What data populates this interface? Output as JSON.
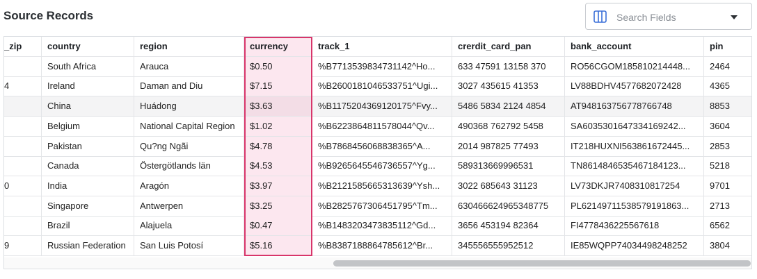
{
  "panel": {
    "title": "Source Records",
    "search": {
      "placeholder": "Search Fields",
      "icon": "columns-icon"
    }
  },
  "colors": {
    "highlight_border": "#d8356a",
    "highlight_fill": "#fce7ef"
  },
  "table": {
    "columns": [
      "_zip",
      "country",
      "region",
      "currency",
      "track_1",
      "crerdit_card_pan",
      "bank_account",
      "pin"
    ],
    "rows": [
      [
        "",
        "South Africa",
        "Arauca",
        "$0.50",
        "%B7713539834731142^Ho...",
        "633 47591 13158 370",
        "RO56CGOM185810214448...",
        "2464"
      ],
      [
        "4",
        "Ireland",
        "Daman and Diu",
        "$7.15",
        "%B2600181046533751^Ugi...",
        "3027 435615 41353",
        "LV88BDHV4577682072428",
        "4365"
      ],
      [
        "",
        "China",
        "Huádong",
        "$3.63",
        "%B1175204369120175^Fvy...",
        "5486 5834 2124 4854",
        "AT948163756778766748",
        "8853"
      ],
      [
        "",
        "Belgium",
        "National Capital Region",
        "$1.02",
        "%B6223864811578044^Qv...",
        "490368 762792 5458",
        "SA603530164733416924​2...",
        "3604"
      ],
      [
        "",
        "Pakistan",
        "Qu?ng Ngãi",
        "$4.78",
        "%B7868456068838365^A...",
        "2014 987825 77493",
        "IT218HUXNI563861672445...",
        "2853"
      ],
      [
        "",
        "Canada",
        "Östergötlands län",
        "$4.53",
        "%B9265645546736557^Yg...",
        "589313669996531",
        "TN8614846535467184123...",
        "5218"
      ],
      [
        "0",
        "India",
        "Aragón",
        "$3.97",
        "%B2121585665313639^Ysh...",
        "3022 685643 31123",
        "LV73DKJR7408310817254",
        "9701"
      ],
      [
        "",
        "Singapore",
        "Antwerpen",
        "$3.25",
        "%B2825767306451795^Tm...",
        "630466624965348775",
        "PL6214971153857919186​3...",
        "2713"
      ],
      [
        "",
        "Brazil",
        "Alajuela",
        "$0.47",
        "%B1483203473835112^Gd...",
        "3656 453194 82364",
        "FI4778436225567618",
        "6562"
      ],
      [
        "9",
        "Russian Federation",
        "San Luis Potosí",
        "$5.16",
        "%B8387188864785612^Br...",
        "345556555952512",
        "IE85WQPP74034498248252",
        "3804"
      ]
    ]
  }
}
